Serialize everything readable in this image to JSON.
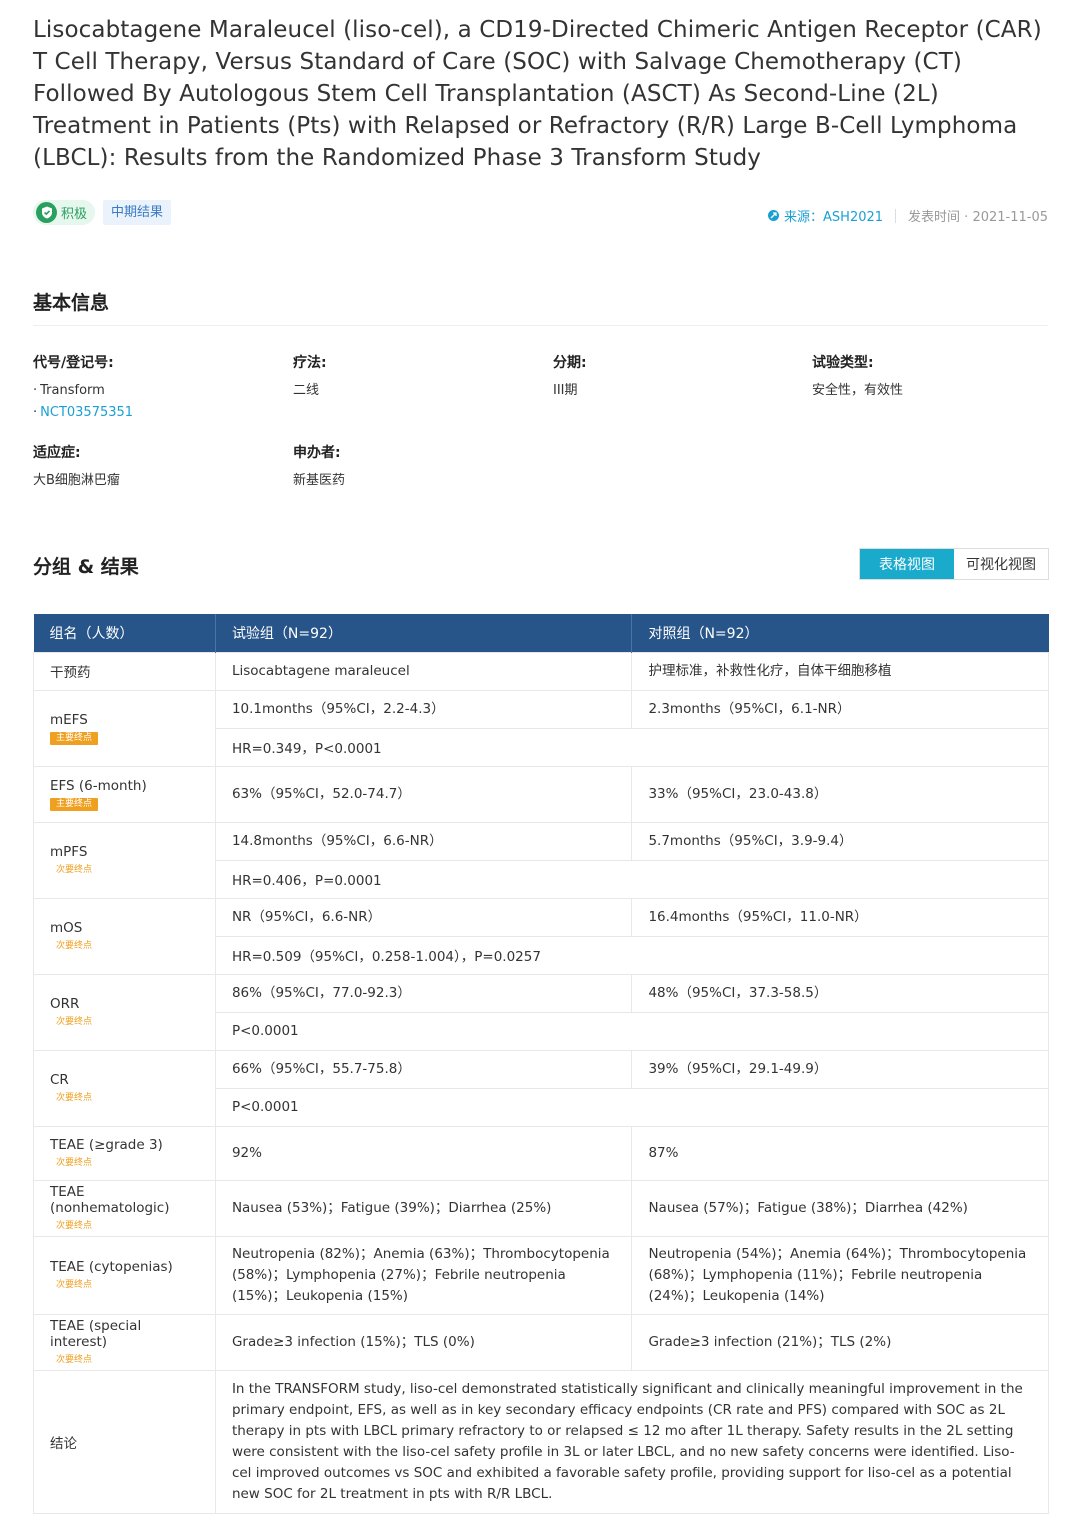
{
  "title": "Lisocabtagene Maraleucel (liso-cel), a CD19-Directed Chimeric Antigen Receptor (CAR) T Cell Therapy, Versus Standard of Care (SOC) with Salvage Chemotherapy (CT) Followed By Autologous Stem Cell Transplantation (ASCT) As Second-Line (2L) Treatment in Patients (Pts) with Relapsed or Refractory (R/R) Large B-Cell Lymphoma (LBCL): Results from the Randomized Phase 3 Transform Study",
  "tags": {
    "positive": "积极",
    "stage": "中期结果"
  },
  "meta": {
    "source": "来源：ASH2021",
    "published": "发表时间 · 2021-11-05"
  },
  "basic_info": {
    "heading": "基本信息",
    "code_label": "代号/登记号:",
    "code_values": [
      "Transform",
      "NCT03575351"
    ],
    "therapy_label": "疗法:",
    "therapy_value": "二线",
    "phase_label": "分期:",
    "phase_value": "III期",
    "trial_type_label": "试验类型:",
    "trial_type_value": "安全性，有效性",
    "indication_label": "适应症:",
    "indication_value": "大B细胞淋巴瘤",
    "sponsor_label": "申办者:",
    "sponsor_value": "新基医药"
  },
  "results": {
    "heading": "分组 & 结果",
    "view_table": "表格视图",
    "view_visual": "可视化视图",
    "headers": [
      "组名（人数）",
      "试验组（N=92）",
      "对照组（N=92）"
    ],
    "rows": [
      {
        "name": "干预药",
        "badge": "",
        "badge_type": "",
        "exp": "Lisocabtagene maraleucel",
        "ctl": "护理标准，补救性化疗，自体干细胞移植",
        "shared": ""
      },
      {
        "name": "mEFS",
        "badge": "主要终点",
        "badge_type": "primary",
        "exp": "10.1months（95%CI，2.2-4.3）",
        "ctl": "2.3months（95%CI，6.1-NR）",
        "shared": "HR=0.349，P<0.0001"
      },
      {
        "name": "EFS (6-month)",
        "badge": "主要终点",
        "badge_type": "primary",
        "exp": "63%（95%CI，52.0-74.7）",
        "ctl": "33%（95%CI，23.0-43.8）",
        "shared": ""
      },
      {
        "name": "mPFS",
        "badge": "次要终点",
        "badge_type": "secondary",
        "exp": "14.8months（95%CI，6.6-NR）",
        "ctl": "5.7months（95%CI，3.9-9.4）",
        "shared": "HR=0.406，P=0.0001"
      },
      {
        "name": "mOS",
        "badge": "次要终点",
        "badge_type": "secondary",
        "exp": "NR（95%CI，6.6-NR）",
        "ctl": "16.4months（95%CI，11.0-NR）",
        "shared": "HR=0.509（95%CI，0.258-1.004），P=0.0257"
      },
      {
        "name": "ORR",
        "badge": "次要终点",
        "badge_type": "secondary",
        "exp": "86%（95%CI，77.0-92.3）",
        "ctl": "48%（95%CI，37.3-58.5）",
        "shared": "P<0.0001"
      },
      {
        "name": "CR",
        "badge": "次要终点",
        "badge_type": "secondary",
        "exp": "66%（95%CI，55.7-75.8）",
        "ctl": "39%（95%CI，29.1-49.9）",
        "shared": "P<0.0001"
      },
      {
        "name": "TEAE (≥grade 3)",
        "badge": "次要终点",
        "badge_type": "secondary",
        "exp": "92%",
        "ctl": "87%",
        "shared": ""
      },
      {
        "name": "TEAE (nonhematologic)",
        "badge": "次要终点",
        "badge_type": "secondary",
        "exp": "Nausea (53%)；Fatigue (39%)；Diarrhea (25%)",
        "ctl": "Nausea (57%)；Fatigue (38%)；Diarrhea (42%)",
        "shared": ""
      },
      {
        "name": "TEAE (cytopenias)",
        "badge": "次要终点",
        "badge_type": "secondary",
        "exp": "Neutropenia (82%)；Anemia (63%)；Thrombocytopenia (58%)；Lymphopenia (27%)；Febrile neutropenia (15%)；Leukopenia (15%)",
        "ctl": "Neutropenia (54%)；Anemia (64%)；Thrombocytopenia (68%)；Lymphopenia (11%)；Febrile neutropenia (24%)；Leukopenia (14%)",
        "shared": ""
      },
      {
        "name": "TEAE (special interest)",
        "badge": "次要终点",
        "badge_type": "secondary",
        "exp": "Grade≥3 infection (15%)；TLS (0%)",
        "ctl": "Grade≥3 infection (21%)；TLS (2%)",
        "shared": ""
      }
    ],
    "conclusion_label": "结论",
    "conclusion": "In the TRANSFORM study, liso-cel demonstrated statistically significant and clinically meaningful improvement in the primary endpoint, EFS, as well as in key secondary efficacy endpoints (CR rate and PFS) compared with SOC as 2L therapy in pts with LBCL primary refractory to or relapsed ≤ 12 mo after 1L therapy. Safety results in the 2L setting were consistent with the liso-cel safety profile in 3L or later LBCL, and no new safety concerns were identified. Liso-cel improved outcomes vs SOC and exhibited a favorable safety profile, providing support for liso-cel as a potential new SOC for 2L treatment in pts with R/R LBCL."
  }
}
